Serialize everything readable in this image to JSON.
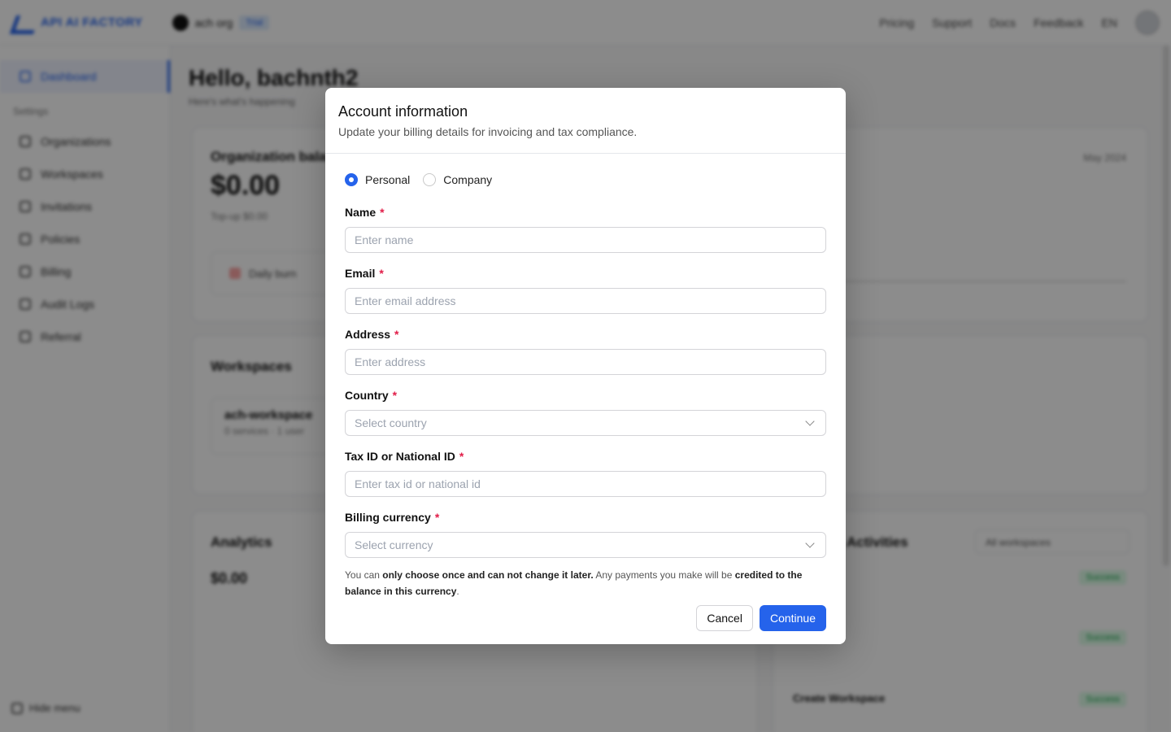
{
  "app": {
    "brand": "API AI FACTORY",
    "org_name": "ach org",
    "org_badge": "Trial",
    "nav": [
      "Pricing",
      "Support",
      "Docs",
      "Feedback"
    ],
    "lang": "EN"
  },
  "sidebar": {
    "active": "Dashboard",
    "section": "Settings",
    "items": [
      "Organizations",
      "Workspaces",
      "Invitations",
      "Policies",
      "Billing",
      "Audit Logs",
      "Referral"
    ],
    "hide_menu": "Hide menu"
  },
  "main": {
    "greeting": "Hello, bachnth2",
    "subtitle": "Here's what's happening",
    "balance_title": "Organization bala",
    "balance_value": "$0.00",
    "topup": "Top-up $0.00",
    "daily_burn": "Daily burn",
    "month": "May 2024",
    "workspaces_title": "Workspaces",
    "workspace_name": "ach-workspace",
    "workspace_meta": "0 services · 1 user",
    "analytics_title": "Analytics",
    "analytics_value": "$0.00",
    "activities_title": "Activities",
    "activities_filter": "All workspaces",
    "activity_status": "Success",
    "activity_create": "Create Workspace"
  },
  "modal": {
    "title": "Account information",
    "subtitle": "Update your billing details for invoicing and tax compliance.",
    "account_types": [
      {
        "label": "Personal",
        "selected": true
      },
      {
        "label": "Company",
        "selected": false
      }
    ],
    "fields": {
      "name": {
        "label": "Name",
        "placeholder": "Enter name",
        "value": ""
      },
      "email": {
        "label": "Email",
        "placeholder": "Enter email address",
        "value": ""
      },
      "address": {
        "label": "Address",
        "placeholder": "Enter address",
        "value": ""
      },
      "country": {
        "label": "Country",
        "placeholder": "Select country"
      },
      "tax_id": {
        "label": "Tax ID or National ID",
        "placeholder": "Enter tax id or national id",
        "value": ""
      },
      "currency": {
        "label": "Billing currency",
        "placeholder": "Select currency"
      }
    },
    "required_mark": "*",
    "note": {
      "p1": "You can ",
      "b1": "only choose once and can not change it later.",
      "p2": " Any payments you make will be ",
      "b2": "credited to the balance in this currency",
      "p3": "."
    },
    "cancel_label": "Cancel",
    "continue_label": "Continue"
  },
  "colors": {
    "primary": "#2563eb",
    "required": "#e11d48",
    "overlay": "rgba(0,0,0,0.45)"
  }
}
